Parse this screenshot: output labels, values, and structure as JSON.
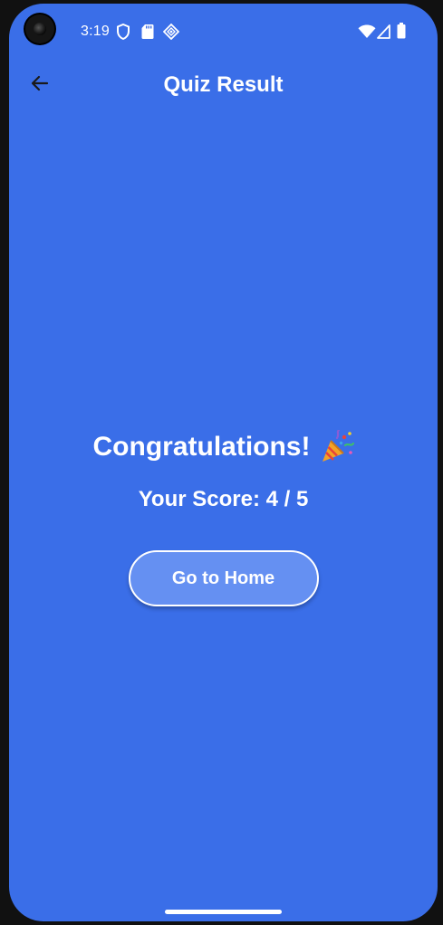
{
  "status_bar": {
    "time": "3:19",
    "left_icons": [
      "shield-icon",
      "sd-card-icon",
      "game-controller-icon"
    ],
    "right_icons": [
      "wifi-icon",
      "cellular-signal-icon",
      "battery-icon"
    ]
  },
  "app_bar": {
    "title": "Quiz Result",
    "back_icon": "arrow-back-icon"
  },
  "result": {
    "congrats_text": "Congratulations!",
    "congrats_emoji": "party-popper-icon",
    "score_text": "Your Score: 4 / 5"
  },
  "actions": {
    "home_label": "Go to Home"
  },
  "colors": {
    "background": "#3a6ee8",
    "button": "#6590f2",
    "text": "#ffffff"
  }
}
